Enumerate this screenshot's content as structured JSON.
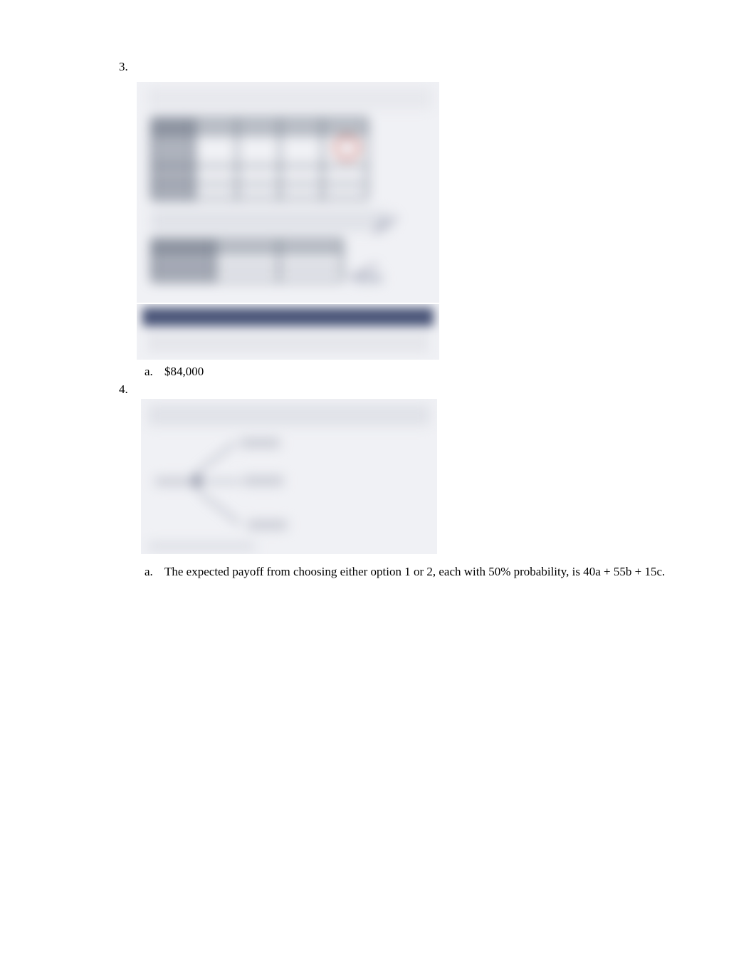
{
  "items": {
    "item3": {
      "number": "3.",
      "sub_a": {
        "letter": "a.",
        "text": "$84,000"
      }
    },
    "item4": {
      "number": "4.",
      "sub_a": {
        "letter": "a.",
        "text": "The expected payoff from choosing either option 1 or 2, each with 50% probability, is 40a + 55b + 15c."
      }
    }
  }
}
